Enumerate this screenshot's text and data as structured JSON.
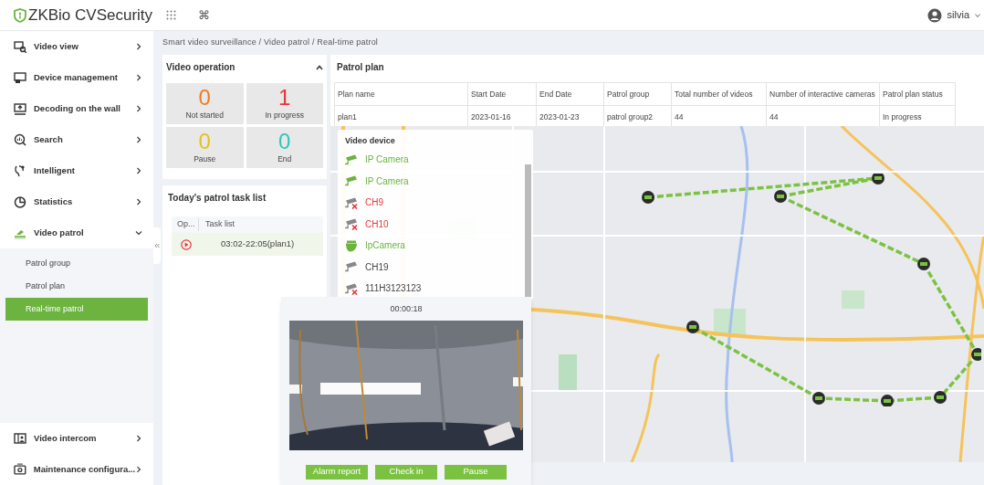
{
  "header": {
    "logo": "ZKBio CVSecurity",
    "shortcut_symbol": "⌘",
    "user": "silvia"
  },
  "sidebar": {
    "items": [
      {
        "label": "Video view",
        "expanded": false
      },
      {
        "label": "Device management",
        "expanded": false
      },
      {
        "label": "Decoding on the wall",
        "expanded": false
      },
      {
        "label": "Search",
        "expanded": false
      },
      {
        "label": "Intelligent",
        "expanded": false
      },
      {
        "label": "Statistics",
        "expanded": false
      },
      {
        "label": "Video patrol",
        "expanded": true,
        "children": [
          {
            "label": "Patrol group",
            "selected": false
          },
          {
            "label": "Patrol plan",
            "selected": false
          },
          {
            "label": "Real-time patrol",
            "selected": true
          }
        ]
      }
    ],
    "bottom_items": [
      {
        "label": "Video intercom",
        "expanded": false
      },
      {
        "label": "Maintenance configura...",
        "expanded": false
      }
    ]
  },
  "breadcrumb": "Smart video surveillance / Video patrol / Real-time patrol",
  "video_operation": {
    "title": "Video operation",
    "counters": [
      {
        "value": "0",
        "label": "Not started",
        "color": "#f07b22"
      },
      {
        "value": "1",
        "label": "In progress",
        "color": "#e8343a"
      },
      {
        "value": "0",
        "label": "Pause",
        "color": "#e6c21a"
      },
      {
        "value": "0",
        "label": "End",
        "color": "#2ec7bd"
      }
    ]
  },
  "task_list": {
    "title": "Today's patrol task list",
    "columns": [
      "Op...",
      "Task list"
    ],
    "rows": [
      {
        "task": "03:02-22:05(plan1)"
      }
    ]
  },
  "patrol_plan": {
    "title": "Patrol plan",
    "columns": [
      "Plan name",
      "Start Date",
      "End Date",
      "Patrol group",
      "Total number of videos",
      "Number of interactive cameras",
      "Patrol plan status"
    ],
    "rows": [
      [
        "plan1",
        "2023-01-16",
        "2023-01-23",
        "patrol group2",
        "44",
        "44",
        "In progress"
      ]
    ]
  },
  "video_device": {
    "title": "Video device",
    "devices": [
      {
        "name": "IP Camera",
        "color": "#6cb33f",
        "offline": false,
        "kind": "bullet"
      },
      {
        "name": "IP Camera",
        "color": "#6cb33f",
        "offline": false,
        "kind": "bullet"
      },
      {
        "name": "CH9",
        "color": "#e8343a",
        "offline": true,
        "kind": "bullet"
      },
      {
        "name": "CH10",
        "color": "#e8343a",
        "offline": true,
        "kind": "bullet"
      },
      {
        "name": "IpCamera",
        "color": "#6cb33f",
        "offline": false,
        "kind": "dome"
      },
      {
        "name": "CH19",
        "color": "#444444",
        "offline": false,
        "kind": "bullet"
      },
      {
        "name": "111H3123123",
        "color": "#444444",
        "offline": true,
        "kind": "bullet"
      }
    ]
  },
  "map": {
    "kind": "picture"
  },
  "video_popup": {
    "time": "00:00:18",
    "video": {
      "kind": "picture"
    },
    "buttons": [
      "Alarm report",
      "Check in",
      "Pause"
    ]
  }
}
